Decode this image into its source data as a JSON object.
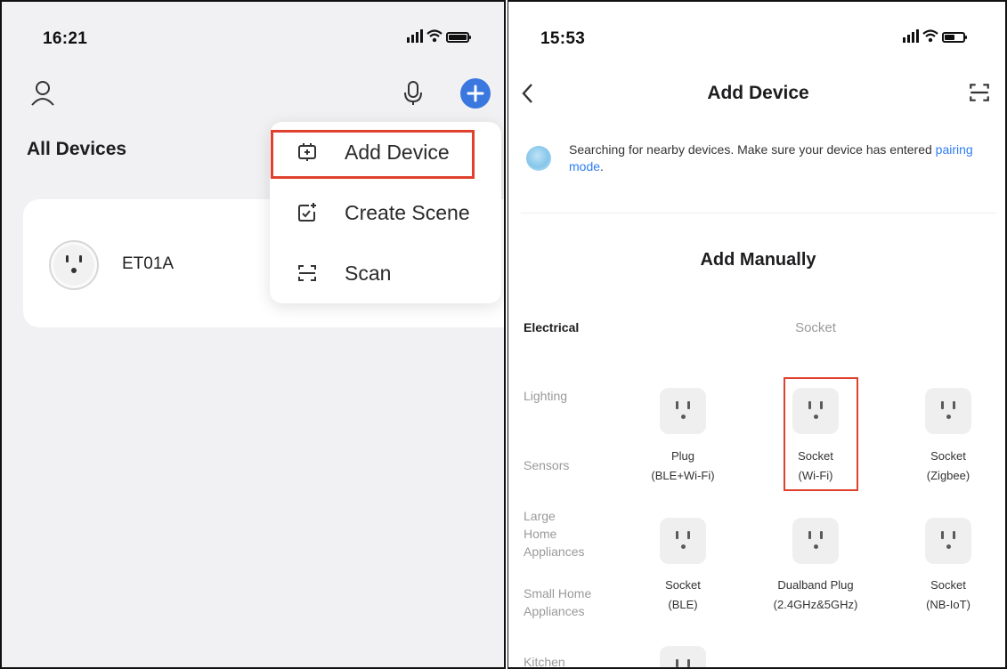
{
  "left": {
    "time": "16:21",
    "title": "All Devices",
    "device": {
      "name": "ET01A"
    },
    "menu": [
      {
        "label": "Add Device",
        "icon": "add-device-icon",
        "highlighted": true
      },
      {
        "label": "Create Scene",
        "icon": "create-scene-icon"
      },
      {
        "label": "Scan",
        "icon": "scan-icon"
      }
    ]
  },
  "right": {
    "time": "15:53",
    "title": "Add Device",
    "search_text_prefix": "Searching for nearby devices. Make sure your device has entered ",
    "search_link": "pairing mode",
    "search_text_suffix": ".",
    "manual_title": "Add Manually",
    "section_label": "Socket",
    "categories": [
      {
        "label": "Electrical",
        "active": true
      },
      {
        "label": "Lighting"
      },
      {
        "label": "Sensors"
      },
      {
        "label": "Large\nHome\nAppliances"
      },
      {
        "label": "Small Home\nAppliances"
      },
      {
        "label": "Kitchen"
      }
    ],
    "devices": [
      {
        "line1": "Plug",
        "line2": "(BLE+Wi-Fi)"
      },
      {
        "line1": "Socket",
        "line2": "(Wi-Fi)",
        "highlighted": true
      },
      {
        "line1": "Socket",
        "line2": "(Zigbee)"
      },
      {
        "line1": "Socket",
        "line2": "(BLE)"
      },
      {
        "line1": "Dualband Plug",
        "line2": "(2.4GHz&5GHz)"
      },
      {
        "line1": "Socket",
        "line2": "(NB-IoT)"
      }
    ]
  },
  "colors": {
    "accent": "#3a78e0",
    "highlight": "#e0412f",
    "link": "#2d7cf0"
  }
}
